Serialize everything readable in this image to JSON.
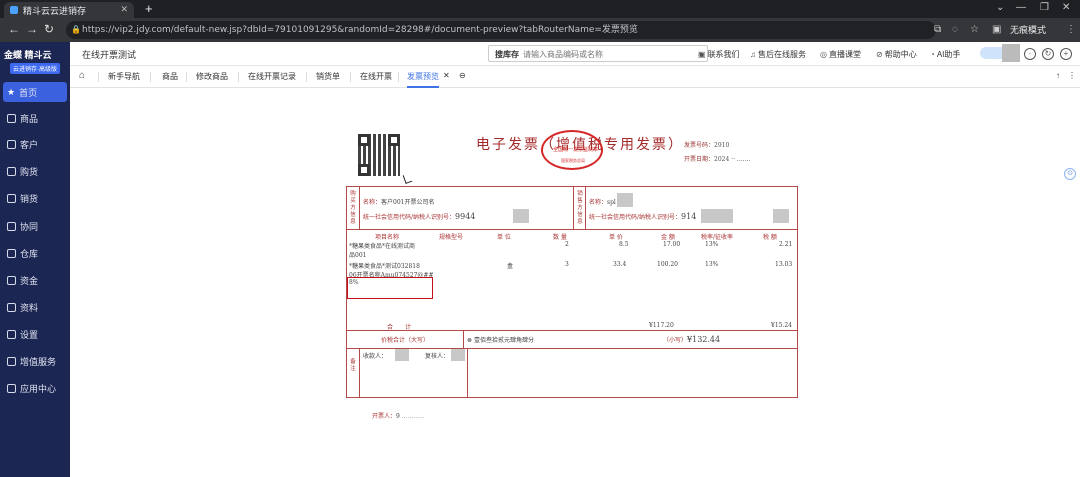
{
  "browser": {
    "tab_title": "精斗云云进销存",
    "url": "https://vip2.jdy.com/default-new.jsp?dbId=79101091295&randomId=28298#/document-preview?tabRouterName=发票预览",
    "incognito_label": "无痕模式",
    "new_tab": "+"
  },
  "sidebar": {
    "logo_text": "金蝶 精斗云",
    "logo_sub": "云进销存·高级版",
    "items": [
      {
        "label": "首页",
        "icon": "star-icon",
        "active": true
      },
      {
        "label": "商品",
        "icon": "goods-icon"
      },
      {
        "label": "客户",
        "icon": "customer-icon"
      },
      {
        "label": "购货",
        "icon": "purchase-icon"
      },
      {
        "label": "销货",
        "icon": "sales-icon"
      },
      {
        "label": "协同",
        "icon": "collab-icon"
      },
      {
        "label": "仓库",
        "icon": "warehouse-icon"
      },
      {
        "label": "资金",
        "icon": "funds-icon"
      },
      {
        "label": "资料",
        "icon": "data-icon"
      },
      {
        "label": "设置",
        "icon": "settings-icon"
      },
      {
        "label": "增值服务",
        "icon": "value-added-icon"
      },
      {
        "label": "应用中心",
        "icon": "app-center-icon"
      }
    ]
  },
  "header": {
    "company": "在线开票测试",
    "search_label": "搜库存",
    "search_placeholder": "请输入商品编码或名称",
    "links": [
      "联系我们",
      "售后在线服务",
      "直播课堂",
      "帮助中心",
      "AI助手"
    ]
  },
  "tabs": [
    "新手导航",
    "商品",
    "修改商品",
    "在线开票记录",
    "销货单",
    "在线开票",
    "发票预览"
  ],
  "active_tab": "发票预览",
  "invoice": {
    "title": "电子发票（增值税专用发票）",
    "invoice_no_label": "发票号码：",
    "invoice_no_value": "2910",
    "date_label": "开票日期：",
    "date_value": "2024",
    "buyer_side_label": "购买方信息",
    "seller_side_label": "销售方信息",
    "buyer_name_label": "名称：",
    "buyer_name_value": "客户001开票公司名",
    "buyer_tax_label": "统一社会信用代码/纳税人识别号：",
    "buyer_tax_value": "9944",
    "seller_name_label": "名称：",
    "seller_name_value": "spl",
    "seller_tax_label": "统一社会信用代码/纳税人识别号：",
    "seller_tax_value": "914",
    "columns": [
      "项目名称",
      "规格型号",
      "单 位",
      "数 量",
      "单 价",
      "金 额",
      "税率/征收率",
      "税 额"
    ],
    "rows": [
      {
        "name": "*糖果类食品*在线测试商",
        "name2": "品001",
        "unit": "",
        "qty": "2",
        "price": "8.5",
        "amount": "17.00",
        "rate": "13%",
        "tax": "2.21"
      },
      {
        "name": "*糖果类食品*测试032818",
        "name2": "06开票名称Amu074527@##",
        "name3": "8%",
        "unit": "盒",
        "qty": "3",
        "price": "33.4",
        "amount": "100.20",
        "rate": "13%",
        "tax": "13.03"
      }
    ],
    "total_label": "合　　计",
    "total_amount": "¥117.20",
    "total_tax": "¥15.24",
    "price_tax_label": "价税合计（大写）",
    "price_tax_upper": "壹佰叁拾贰元肆角肆分",
    "price_tax_small_label": "（小写）",
    "price_tax_small": "¥132.44",
    "remark_label": "备注",
    "payee_label": "收款人：",
    "reviewer_label": "复核人：",
    "drawer_label": "开票人：",
    "drawer_value": "9",
    "seal_top": "全国统一发票监制章",
    "seal_bottom": "国家税务总局"
  }
}
